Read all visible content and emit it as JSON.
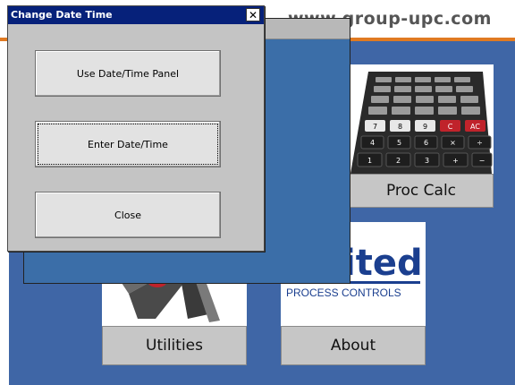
{
  "header": {
    "url_text": "www.group-upc.com"
  },
  "tiles": {
    "proc_calc": {
      "label": "Proc Calc"
    },
    "utilities": {
      "label": "Utilities"
    },
    "about": {
      "label": "About",
      "logo_text": "ited",
      "logo_subtext": "PROCESS CONTROLS"
    }
  },
  "calculator_keys": {
    "row1": [
      "7",
      "8",
      "9",
      "C",
      "AC"
    ],
    "row2": [
      "4",
      "5",
      "6",
      "×",
      "÷"
    ],
    "row3": [
      "1",
      "2",
      "3",
      "+",
      "−"
    ]
  },
  "dialog": {
    "title": "Change Date Time",
    "close_icon": "close-icon",
    "buttons": {
      "panel": "Use Date/Time Panel",
      "enter": "Enter Date/Time",
      "close": "Close"
    }
  },
  "colors": {
    "desktop_blue": "#3f66a6",
    "titlebar_blue": "#06217a",
    "accent_orange": "#e07a22",
    "logo_blue": "#1b3f8f"
  }
}
